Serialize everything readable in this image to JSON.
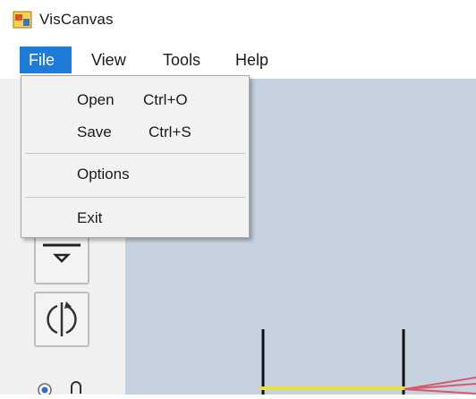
{
  "window": {
    "title": "VisCanvas",
    "icon": "app-icon"
  },
  "menubar": {
    "items": [
      {
        "label": "File",
        "active": true
      },
      {
        "label": "View"
      },
      {
        "label": "Tools"
      },
      {
        "label": "Help"
      }
    ]
  },
  "file_menu": {
    "items": [
      {
        "label": "Open",
        "shortcut": "Ctrl+O"
      },
      {
        "label": "Save",
        "shortcut": "Ctrl+S"
      },
      {
        "label": "Options"
      },
      {
        "label": "Exit"
      }
    ]
  },
  "toolbar": {
    "buttons": [
      {
        "icon": "flip-down-icon"
      },
      {
        "icon": "rotate-icon"
      }
    ],
    "radio_icon": "radio-icon"
  },
  "colors": {
    "menu_highlight": "#1e7bd7",
    "canvas_background": "#c6d2e0",
    "line_yellow": "#e8e23a",
    "line_red": "#d85a6a",
    "axis_black": "#111111"
  }
}
